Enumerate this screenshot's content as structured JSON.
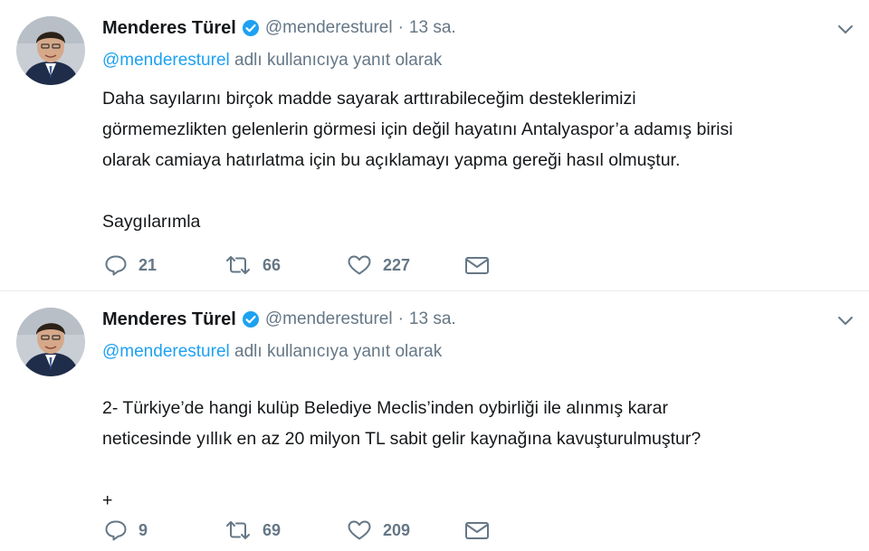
{
  "tweets": [
    {
      "author_name": "Menderes Türel",
      "handle": "@menderesturel",
      "dot": "·",
      "time": "13 sa.",
      "reply_mention": "@menderesturel",
      "reply_suffix": " adlı kullanıcıya yanıt olarak",
      "text_lines": [
        "Daha sayılarını birçok madde sayarak arttırabileceğim desteklerimizi",
        "görmemezlikten gelenlerin görmesi için değil hayatını Antalyaspor’a adamış birisi",
        "olarak camiaya hatırlatma için bu açıklamayı yapma gereği hasıl olmuştur.",
        "",
        "Saygılarımla"
      ],
      "replies": "21",
      "retweets": "66",
      "likes": "227"
    },
    {
      "author_name": "Menderes Türel",
      "handle": "@menderesturel",
      "dot": "·",
      "time": "13 sa.",
      "reply_mention": "@menderesturel",
      "reply_suffix": " adlı kullanıcıya yanıt olarak",
      "text_lines": [
        "2- Türkiye’de hangi kulüp Belediye Meclis’inden oybirliği ile alınmış karar",
        "neticesinde yıllık en az 20 milyon TL sabit gelir kaynağına kavuşturulmuştur?",
        "",
        "+"
      ],
      "replies": "9",
      "retweets": "69",
      "likes": "209"
    }
  ],
  "icons": {
    "verified": "verified-badge-icon",
    "chevron": "chevron-down-icon",
    "reply": "reply-icon",
    "retweet": "retweet-icon",
    "like": "heart-icon",
    "message": "direct-message-icon"
  },
  "colors": {
    "text": "#14171a",
    "secondary": "#657786",
    "link": "#1da1f2",
    "divider": "#e6ecf0"
  }
}
